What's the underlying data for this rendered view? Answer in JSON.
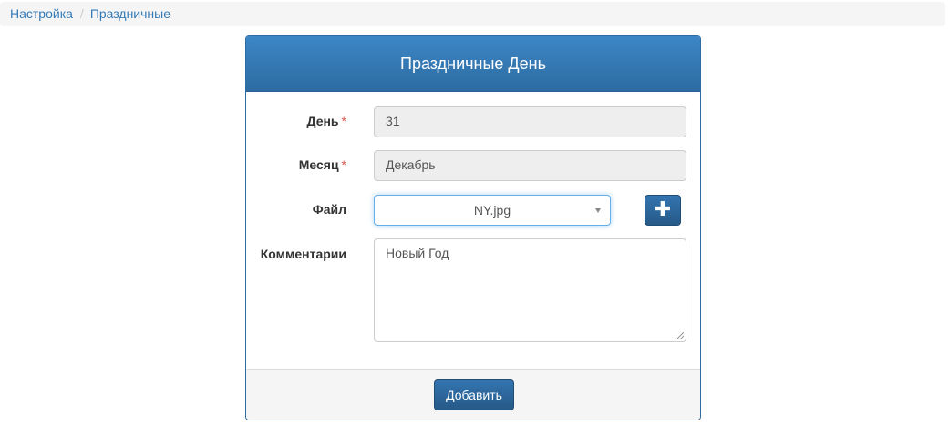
{
  "breadcrumb": {
    "items": [
      "Настройка",
      "Праздничные"
    ],
    "separator": "/"
  },
  "panel": {
    "title": "Праздничные День"
  },
  "form": {
    "day": {
      "label": "День",
      "required_mark": "*",
      "value": "31"
    },
    "month": {
      "label": "Месяц",
      "required_mark": "*",
      "value": "Декабрь"
    },
    "file": {
      "label": "Файл",
      "selected": "NY.jpg",
      "add_icon": "plus-icon"
    },
    "comment": {
      "label": "Комментарии",
      "value": "Новый Год"
    }
  },
  "footer": {
    "submit_label": "Добавить"
  },
  "colors": {
    "primary": "#337ab7",
    "required": "#d9534f",
    "link": "#337ab7"
  }
}
